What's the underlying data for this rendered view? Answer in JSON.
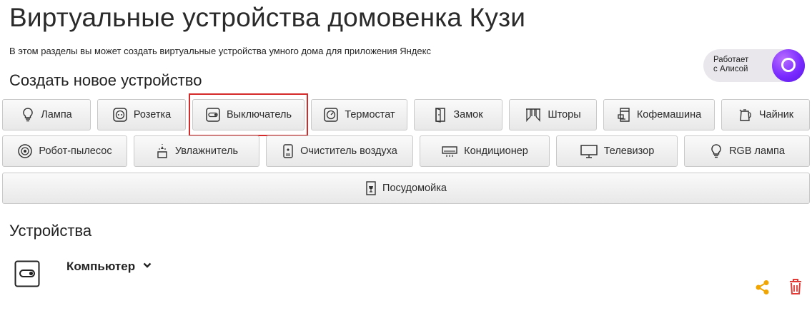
{
  "page": {
    "title": "Виртуальные устройства домовенка Кузи",
    "subtitle": "В этом разделы вы может создать виртуальные устройства умного дома для приложения Яндекс"
  },
  "alice_badge": {
    "line1": "Работает",
    "line2": "с Алисой"
  },
  "create": {
    "heading": "Создать новое устройство",
    "buttons": [
      {
        "label": "Лампа",
        "icon": "lamp-icon"
      },
      {
        "label": "Розетка",
        "icon": "socket-icon"
      },
      {
        "label": "Выключатель",
        "icon": "switch-icon"
      },
      {
        "label": "Термостат",
        "icon": "thermostat-icon"
      },
      {
        "label": "Замок",
        "icon": "lock-icon"
      },
      {
        "label": "Шторы",
        "icon": "curtains-icon"
      },
      {
        "label": "Кофемашина",
        "icon": "coffee-machine-icon"
      },
      {
        "label": "Чайник",
        "icon": "kettle-icon"
      },
      {
        "label": "Робот-пылесос",
        "icon": "robot-vacuum-icon"
      },
      {
        "label": "Увлажнитель",
        "icon": "humidifier-icon"
      },
      {
        "label": "Очиститель воздуха",
        "icon": "air-purifier-icon"
      },
      {
        "label": "Кондиционер",
        "icon": "air-conditioner-icon"
      },
      {
        "label": "Телевизор",
        "icon": "tv-icon"
      },
      {
        "label": "RGB лампа",
        "icon": "rgb-lamp-icon"
      },
      {
        "label": "Посудомойка",
        "icon": "dishwasher-icon"
      }
    ]
  },
  "devices": {
    "heading": "Устройства",
    "items": [
      {
        "name": "Компьютер",
        "icon": "switch-icon"
      }
    ]
  },
  "colors": {
    "share": "#f0a500",
    "delete": "#e53935",
    "highlight": "#d42a2a",
    "alice": "#7a2bff"
  }
}
